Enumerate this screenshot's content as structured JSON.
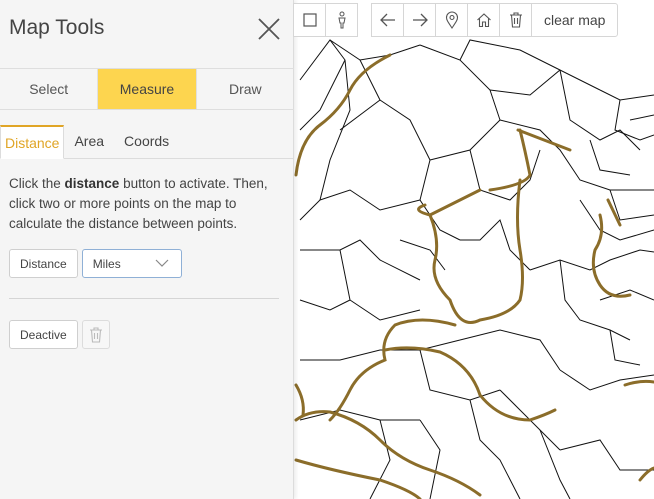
{
  "panel": {
    "title": "Map Tools",
    "main_tabs": [
      {
        "label": "Select"
      },
      {
        "label": "Measure",
        "active": true
      },
      {
        "label": "Draw"
      }
    ],
    "sub_tabs": [
      {
        "label": "Distance",
        "active": true
      },
      {
        "label": "Area"
      },
      {
        "label": "Coords"
      }
    ],
    "help": {
      "prefix": "Click the ",
      "bold": "distance",
      "suffix": " button to activate. Then, click two or more points on the map to calculate the distance between points."
    },
    "distance_button": "Distance",
    "units_select": "Miles",
    "deactive_button": "Deactive"
  },
  "toolbar": {
    "clear_label": "clear map",
    "icons": [
      "square-select-icon",
      "person-icon",
      "arrow-left-icon",
      "arrow-right-icon",
      "map-pin-icon",
      "home-icon",
      "trash-icon"
    ]
  },
  "colors": {
    "accent": "#fdd54f",
    "accent_text": "#e0a526",
    "road": "#8b6d2a"
  }
}
